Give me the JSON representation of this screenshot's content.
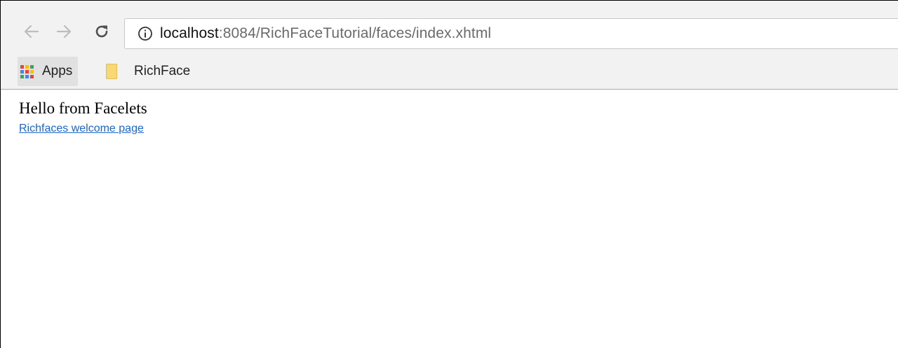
{
  "browser": {
    "url": {
      "host": "localhost",
      "path": ":8084/RichFaceTutorial/faces/index.xhtml"
    },
    "nav": {
      "back_icon": "arrow-left-icon",
      "forward_icon": "arrow-right-icon",
      "reload_icon": "reload-icon",
      "info_icon": "info-icon"
    },
    "bookmarks": {
      "apps_label": "Apps",
      "folder_label": "RichFace"
    },
    "colors": {
      "apps_grid": [
        "#ea4335",
        "#fbbc05",
        "#34a853",
        "#4285f4",
        "#ea4335",
        "#fbbc05",
        "#34a853",
        "#4285f4",
        "#ea4335"
      ],
      "link": "#1a66cc",
      "folder": "#f8d775"
    }
  },
  "page": {
    "heading": "Hello from Facelets",
    "link_text": "Richfaces welcome page"
  }
}
